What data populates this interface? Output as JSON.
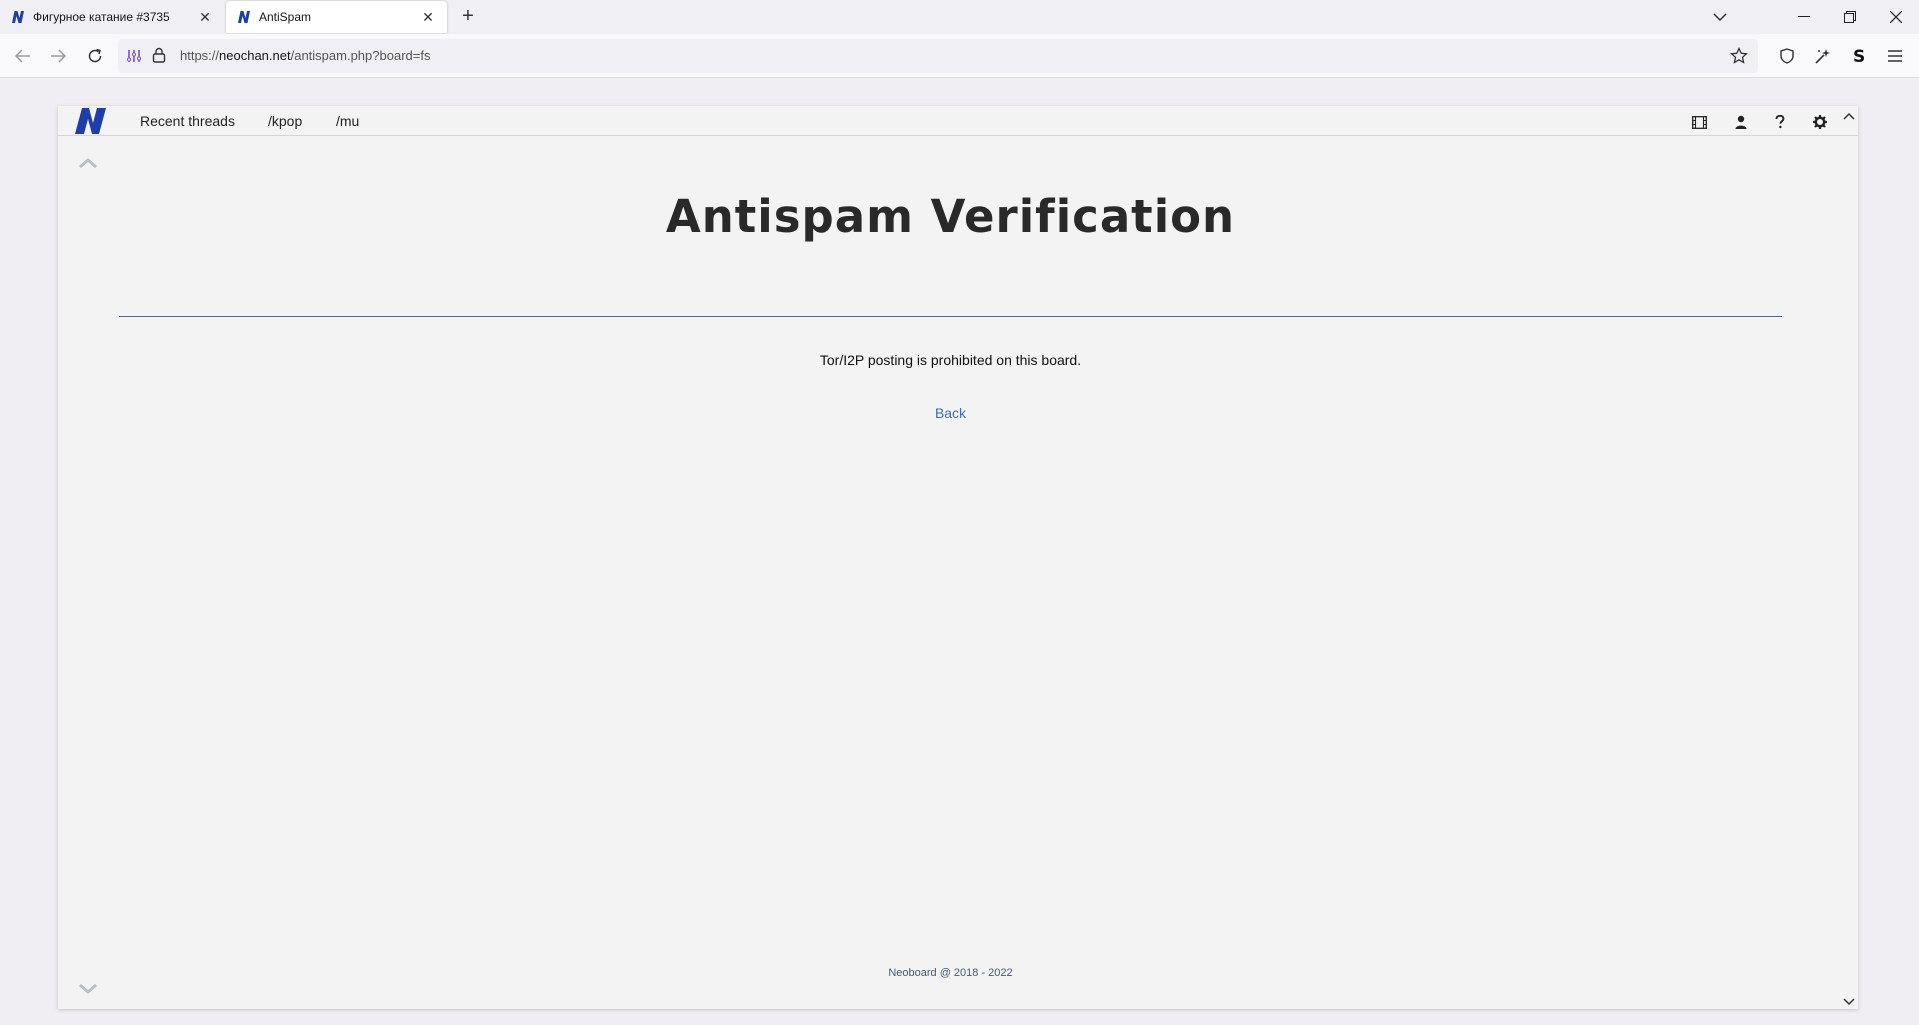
{
  "browser": {
    "tabs": [
      {
        "title": "Фигурное катание #3735",
        "favicon": "neochan-logo-icon",
        "active": false
      },
      {
        "title": "AntiSpam",
        "favicon": "neochan-logo-icon",
        "active": true
      }
    ],
    "url_scheme": "https://",
    "url_host": "neochan.net",
    "url_path": "/antispam.php?board=fs"
  },
  "site": {
    "nav": [
      {
        "label": "Recent threads"
      },
      {
        "label": "/kpop"
      },
      {
        "label": "/mu"
      }
    ],
    "tool_icons": [
      "video-icon",
      "user-icon",
      "help-icon",
      "settings-icon"
    ]
  },
  "main": {
    "heading": "Antispam Verification",
    "message": "Tor/I2P posting is prohibited on this board.",
    "back_label": "Back"
  },
  "footer": {
    "text": "Neoboard @ 2018 - 2022"
  },
  "colors": {
    "link": "#3f6ea8",
    "logo": "#1e3fa8",
    "page_bg": "#f3f3f3"
  }
}
